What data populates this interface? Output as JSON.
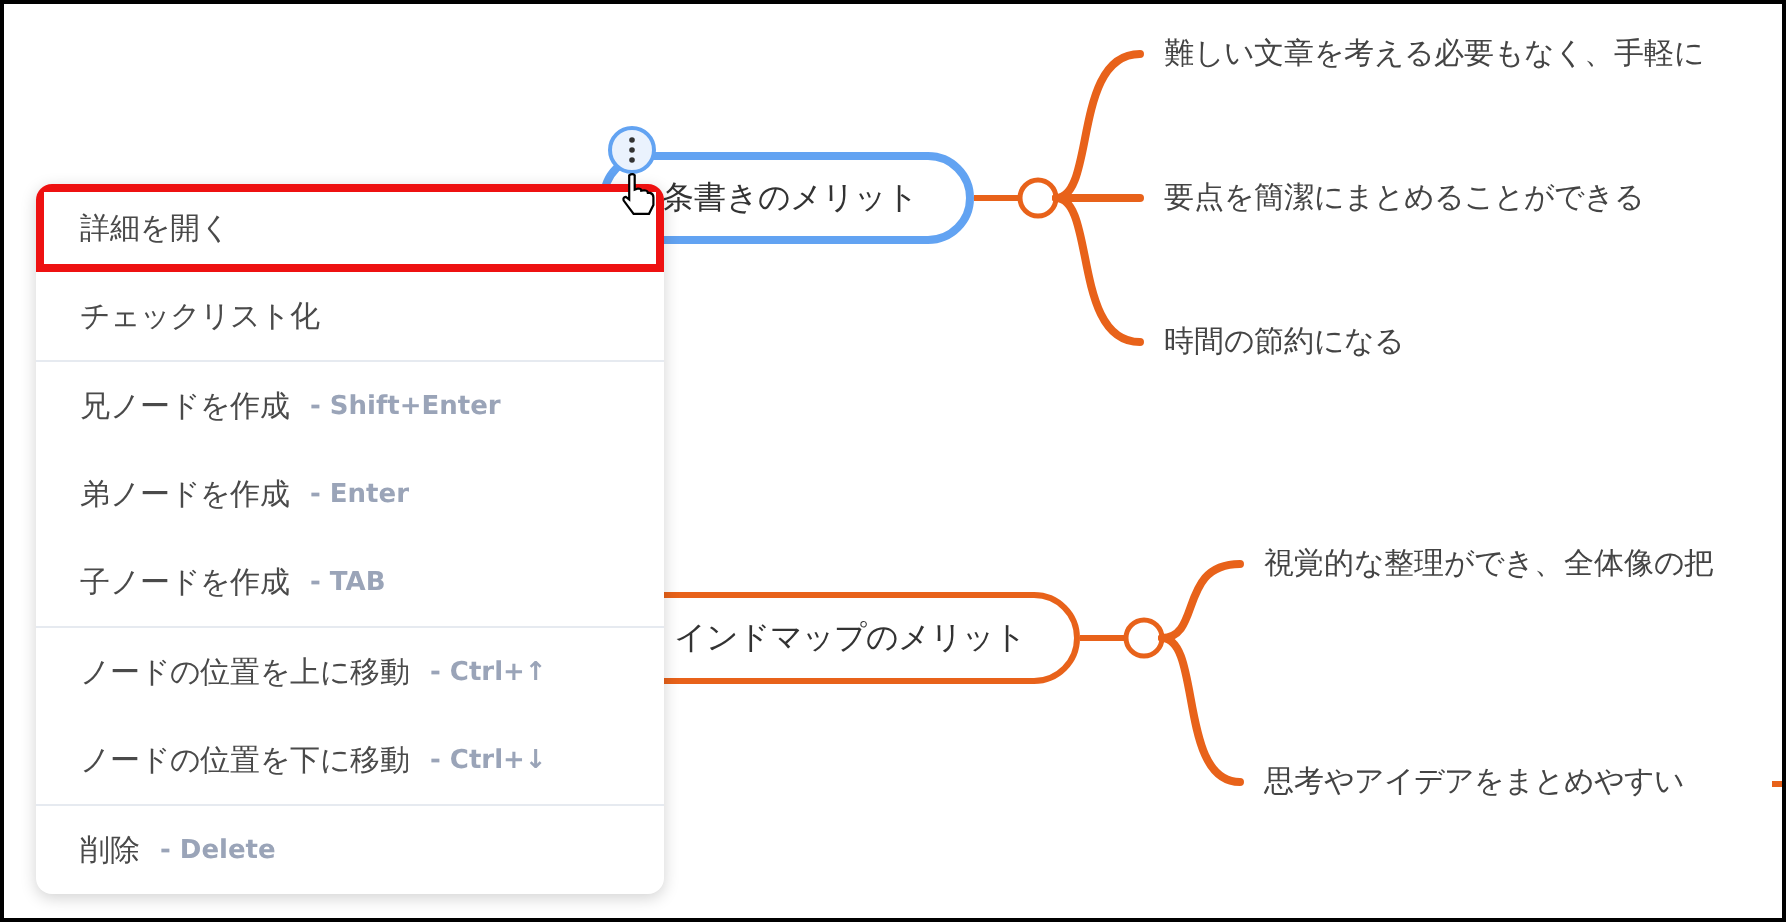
{
  "mind_map": {
    "topics": [
      {
        "label": "条書きのメリット",
        "selected": true,
        "children": [
          {
            "label": "難しい文章を考える必要もなく、手軽に"
          },
          {
            "label": "要点を簡潔にまとめることができる"
          },
          {
            "label": "時間の節約になる"
          }
        ]
      },
      {
        "label": "インドマップのメリット",
        "selected": false,
        "children": [
          {
            "label": "視覚的な整理ができ、全体像の把"
          },
          {
            "label": "思考やアイデアをまとめやすい"
          }
        ]
      }
    ]
  },
  "context_menu": {
    "groups": [
      [
        {
          "label": "詳細を開く",
          "highlighted": true
        },
        {
          "label": "チェックリスト化",
          "highlighted": false
        }
      ],
      [
        {
          "label": "兄ノードを作成",
          "shortcut": "- Shift+Enter",
          "highlighted": false
        },
        {
          "label": "弟ノードを作成",
          "shortcut": "- Enter",
          "highlighted": false
        },
        {
          "label": "子ノードを作成",
          "shortcut": "- TAB",
          "highlighted": false
        }
      ],
      [
        {
          "label": "ノードの位置を上に移動",
          "shortcut": "- Ctrl+↑",
          "highlighted": false
        },
        {
          "label": "ノードの位置を下に移動",
          "shortcut": "- Ctrl+↓",
          "highlighted": false
        }
      ],
      [
        {
          "label": "削除",
          "shortcut": "- Delete",
          "highlighted": false
        }
      ]
    ]
  }
}
